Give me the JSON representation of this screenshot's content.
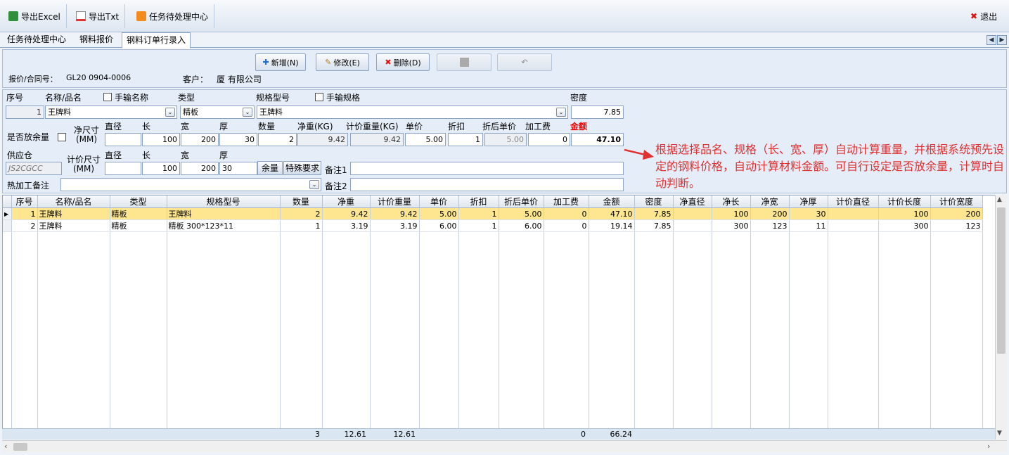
{
  "toolbar": {
    "export_excel": "导出Excel",
    "export_txt": "导出Txt",
    "task_center": "任务待处理中心",
    "exit": "退出"
  },
  "tabs": [
    {
      "label": "任务待处理中心"
    },
    {
      "label": "钢料报价"
    },
    {
      "label": "钢料订单行录入"
    }
  ],
  "actions": {
    "add": "新增(N)",
    "edit": "修改(E)",
    "delete": "删除(D)"
  },
  "header": {
    "quote_label": "报价/合同号：",
    "quote_value": "GL20  0904-0006",
    "customer_label": "客户：",
    "customer_value": "厦         有限公司"
  },
  "form": {
    "seq_label": "序号",
    "seq_value": "1",
    "name_label": "名称/品名",
    "name_value": "王牌料",
    "manual_name_label": "手输名称",
    "type_label": "类型",
    "type_value": "精板",
    "spec_label": "规格型号",
    "spec_value": "王牌料",
    "manual_spec_label": "手输规格",
    "density_label": "密度",
    "density_value": "7.85",
    "allowance_label": "是否放余量",
    "net_size_label": "净尺寸(MM)",
    "diameter_label": "直径",
    "length_label": "长",
    "width_label": "宽",
    "thickness_label": "厚",
    "net_len": "100",
    "net_wid": "200",
    "net_thk": "30",
    "qty_label": "数量",
    "qty_value": "2",
    "net_weight_label": "净重(KG)",
    "net_weight_value": "9.42",
    "calc_weight_label": "计价重量(KG)",
    "calc_weight_value": "9.42",
    "price_label": "单价",
    "price_value": "5.00",
    "discount_label": "折扣",
    "discount_value": "1",
    "disc_price_label": "折后单价",
    "disc_price_value": "5.00",
    "process_fee_label": "加工费",
    "process_fee_value": "0",
    "amount_label": "金额",
    "amount_value": "47.10",
    "supplier_label": "供应仓",
    "supplier_value": "JS2CGCC",
    "calc_size_label": "计价尺寸(MM)",
    "calc_len": "100",
    "calc_wid": "200",
    "calc_thk": "30",
    "allowance_btn": "余量",
    "special_btn": "特殊要求",
    "remark1_label": "备注1",
    "remark2_label": "备注2",
    "heat_label": "热加工备注"
  },
  "note": "根据选择品名、规格（长、宽、厚）自动计算重量，并根据系统预先设定的钢料价格，自动计算材料金额。可自行设定是否放余量，计算时自动判断。",
  "grid": {
    "columns": [
      "序号",
      "名称/品名",
      "类型",
      "规格型号",
      "数量",
      "净重",
      "计价重量",
      "单价",
      "折扣",
      "折后单价",
      "加工费",
      "金额",
      "密度",
      "净直径",
      "净长",
      "净宽",
      "净厚",
      "计价直径",
      "计价长度",
      "计价宽度"
    ],
    "rows": [
      [
        "1",
        "王牌料",
        "精板",
        "王牌料",
        "2",
        "9.42",
        "9.42",
        "5.00",
        "1",
        "5.00",
        "0",
        "47.10",
        "7.85",
        "",
        "100",
        "200",
        "30",
        "",
        "100",
        "200"
      ],
      [
        "2",
        "王牌料",
        "精板",
        "精板 300*123*11",
        "1",
        "3.19",
        "3.19",
        "6.00",
        "1",
        "6.00",
        "0",
        "19.14",
        "7.85",
        "",
        "300",
        "123",
        "11",
        "",
        "300",
        "123"
      ]
    ],
    "totals": {
      "qty": "3",
      "net": "12.61",
      "calc": "12.61",
      "fee": "0",
      "amount": "66.24"
    }
  },
  "colors": {
    "accent_red": "#e03030",
    "selected_row": "#fde68f"
  }
}
